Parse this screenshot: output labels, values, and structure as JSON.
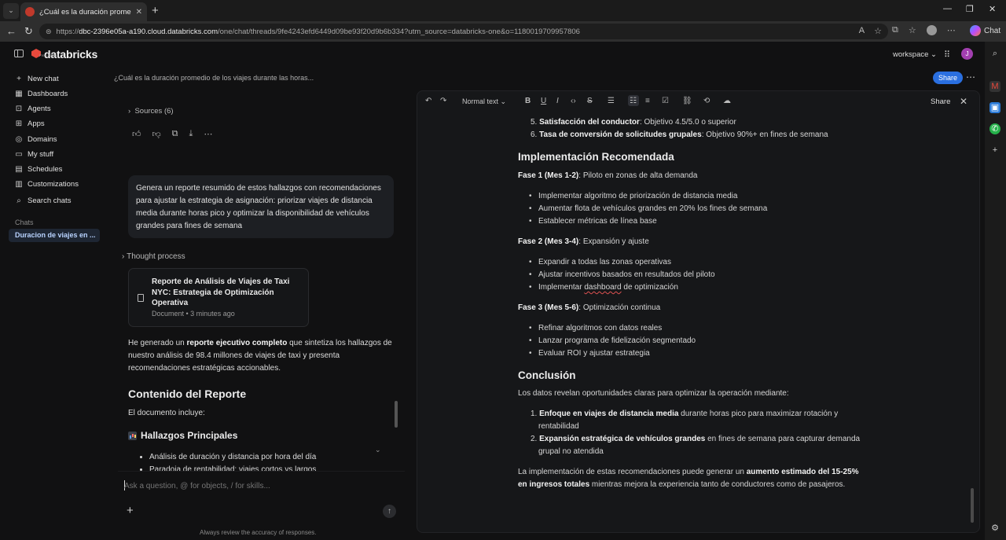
{
  "browser": {
    "tab_title": "¿Cuál es la duración promedio de",
    "url_prefix": "https://",
    "url_host": "dbc-2396e05a-a190.cloud.databricks.com",
    "url_path": "/one/chat/threads/9fe4243efd6449d09be93f20d9b6b334?utm_source=databricks-one&o=1180019709957806",
    "copilot_label": "Chat"
  },
  "app": {
    "brand_name": "databricks",
    "brand_sub": "Free Edition",
    "workspace_label": "workspace",
    "avatar_initial": "J",
    "chat_title": "¿Cuál es la duración promedio de los viajes durante las horas...",
    "share_label": "Share"
  },
  "nav": {
    "items": [
      {
        "label": "New chat",
        "icon": "plus-icon"
      },
      {
        "label": "Dashboards",
        "icon": "dashboard-icon"
      },
      {
        "label": "Agents",
        "icon": "agents-icon"
      },
      {
        "label": "Apps",
        "icon": "apps-icon"
      },
      {
        "label": "Domains",
        "icon": "domains-icon"
      },
      {
        "label": "My stuff",
        "icon": "folder-icon"
      },
      {
        "label": "Schedules",
        "icon": "calendar-icon"
      },
      {
        "label": "Customizations",
        "icon": "customizations-icon"
      },
      {
        "label": "Search chats",
        "icon": "search-icon"
      }
    ],
    "chats_section": "Chats",
    "active_chat": "Duracion de viajes en ..."
  },
  "chat": {
    "sources_label": "Sources (6)",
    "user_message": "Genera un reporte resumido de estos hallazgos con recomendaciones para ajustar la estrategia de asignación: priorizar viajes de distancia media durante horas pico y optimizar la disponibilidad de vehículos grandes para fines de semana",
    "thought_label": "Thought process",
    "doc_title": "Reporte de Análisis de Viajes de Taxi NYC: Estrategia de Optimización Operativa",
    "doc_meta": "Document • 3 minutes ago",
    "reply_pre": "He generado un ",
    "reply_bold": "reporte ejecutivo completo",
    "reply_post": " que sintetiza los hallazgos de nuestro análisis de 98.4 millones de viajes de taxi y presenta recomendaciones estratégicas accionables.",
    "heading": "Contenido del Reporte",
    "intro": "El documento incluye:",
    "subheading": "Hallazgos Principales",
    "list": [
      "Análisis de duración y distancia por hora del día",
      "Paradoja de rentabilidad: viajes cortos vs largos"
    ],
    "input_placeholder": "Ask a question, @ for objects, / for skills...",
    "disclaimer": "Always review the accuracy of responses."
  },
  "doc": {
    "toolbar_style": "Normal text",
    "share_label": "Share",
    "ol_top": [
      {
        "num": "5.",
        "bold": "Satisfacción del conductor",
        "text": ": Objetivo 4.5/5.0 o superior"
      },
      {
        "num": "6.",
        "bold": "Tasa de conversión de solicitudes grupales",
        "text": ": Objetivo 90%+ en fines de semana"
      }
    ],
    "h_impl": "Implementación Recomendada",
    "phase1_bold": "Fase 1 (Mes 1-2)",
    "phase1_text": ": Piloto en zonas de alta demanda",
    "phase1_items": [
      "Implementar algoritmo de priorización de distancia media",
      "Aumentar flota de vehículos grandes en 20% los fines de semana",
      "Establecer métricas de línea base"
    ],
    "phase2_bold": "Fase 2 (Mes 3-4)",
    "phase2_text": ": Expansión y ajuste",
    "phase2_items": [
      "Expandir a todas las zonas operativas",
      "Ajustar incentivos basados en resultados del piloto"
    ],
    "phase2_item3_pre": "Implementar ",
    "phase2_item3_word": "dashboard",
    "phase2_item3_post": " de optimización",
    "phase3_bold": "Fase 3 (Mes 5-6)",
    "phase3_text": ": Optimización continua",
    "phase3_items": [
      "Refinar algoritmos con datos reales",
      "Lanzar programa de fidelización segmentado",
      "Evaluar ROI y ajustar estrategia"
    ],
    "h_concl": "Conclusión",
    "concl_intro": "Los datos revelan oportunidades claras para optimizar la operación mediante:",
    "concl_1_bold": "Enfoque en viajes de distancia media",
    "concl_1_text": " durante horas pico para maximizar rotación y",
    "concl_1_cont": "rentabilidad",
    "concl_2_bold": "Expansión estratégica de vehículos grandes",
    "concl_2_text": " en fines de semana para capturar demanda",
    "concl_2_cont": "grupal no atendida",
    "final_pre": "La implementación de estas recomendaciones puede generar un ",
    "final_bold_1": "aumento estimado del 15-25%",
    "final_bold_2": "en ingresos totales",
    "final_post": " mientras mejora la experiencia tanto de conductores como de pasajeros."
  }
}
